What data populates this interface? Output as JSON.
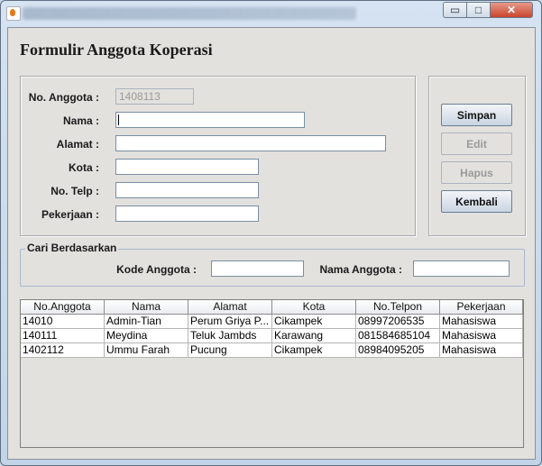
{
  "form": {
    "title": "Formulir Anggota Koperasi",
    "labels": {
      "no_anggota": "No. Anggota :",
      "nama": "Nama :",
      "alamat": "Alamat :",
      "kota": "Kota :",
      "no_telp": "No. Telp :",
      "pekerjaan": "Pekerjaan :"
    },
    "values": {
      "no_anggota": "1408113",
      "nama": "",
      "alamat": "",
      "kota": "",
      "no_telp": "",
      "pekerjaan": ""
    }
  },
  "buttons": {
    "simpan": "Simpan",
    "edit": "Edit",
    "hapus": "Hapus",
    "kembali": "Kembali"
  },
  "search": {
    "legend": "Cari Berdasarkan",
    "kode_label": "Kode Anggota :",
    "nama_label": "Nama Anggota :",
    "kode_value": "",
    "nama_value": ""
  },
  "table": {
    "columns": [
      "No.Anggota",
      "Nama",
      "Alamat",
      "Kota",
      "No.Telpon",
      "Pekerjaan"
    ],
    "rows": [
      [
        "14010",
        "Admin-Tian",
        "Perum Griya P...",
        "Cikampek",
        "08997206535",
        "Mahasiswa"
      ],
      [
        "140111",
        "Meydina",
        "Teluk Jambds",
        "Karawang",
        "081584685104",
        "Mahasiswa"
      ],
      [
        "1402112",
        "Ummu Farah",
        "Pucung",
        "Cikampek",
        "08984095205",
        "Mahasiswa"
      ]
    ]
  },
  "window_buttons": {
    "minimize": "▭",
    "maximize": "□",
    "close": "✕"
  }
}
